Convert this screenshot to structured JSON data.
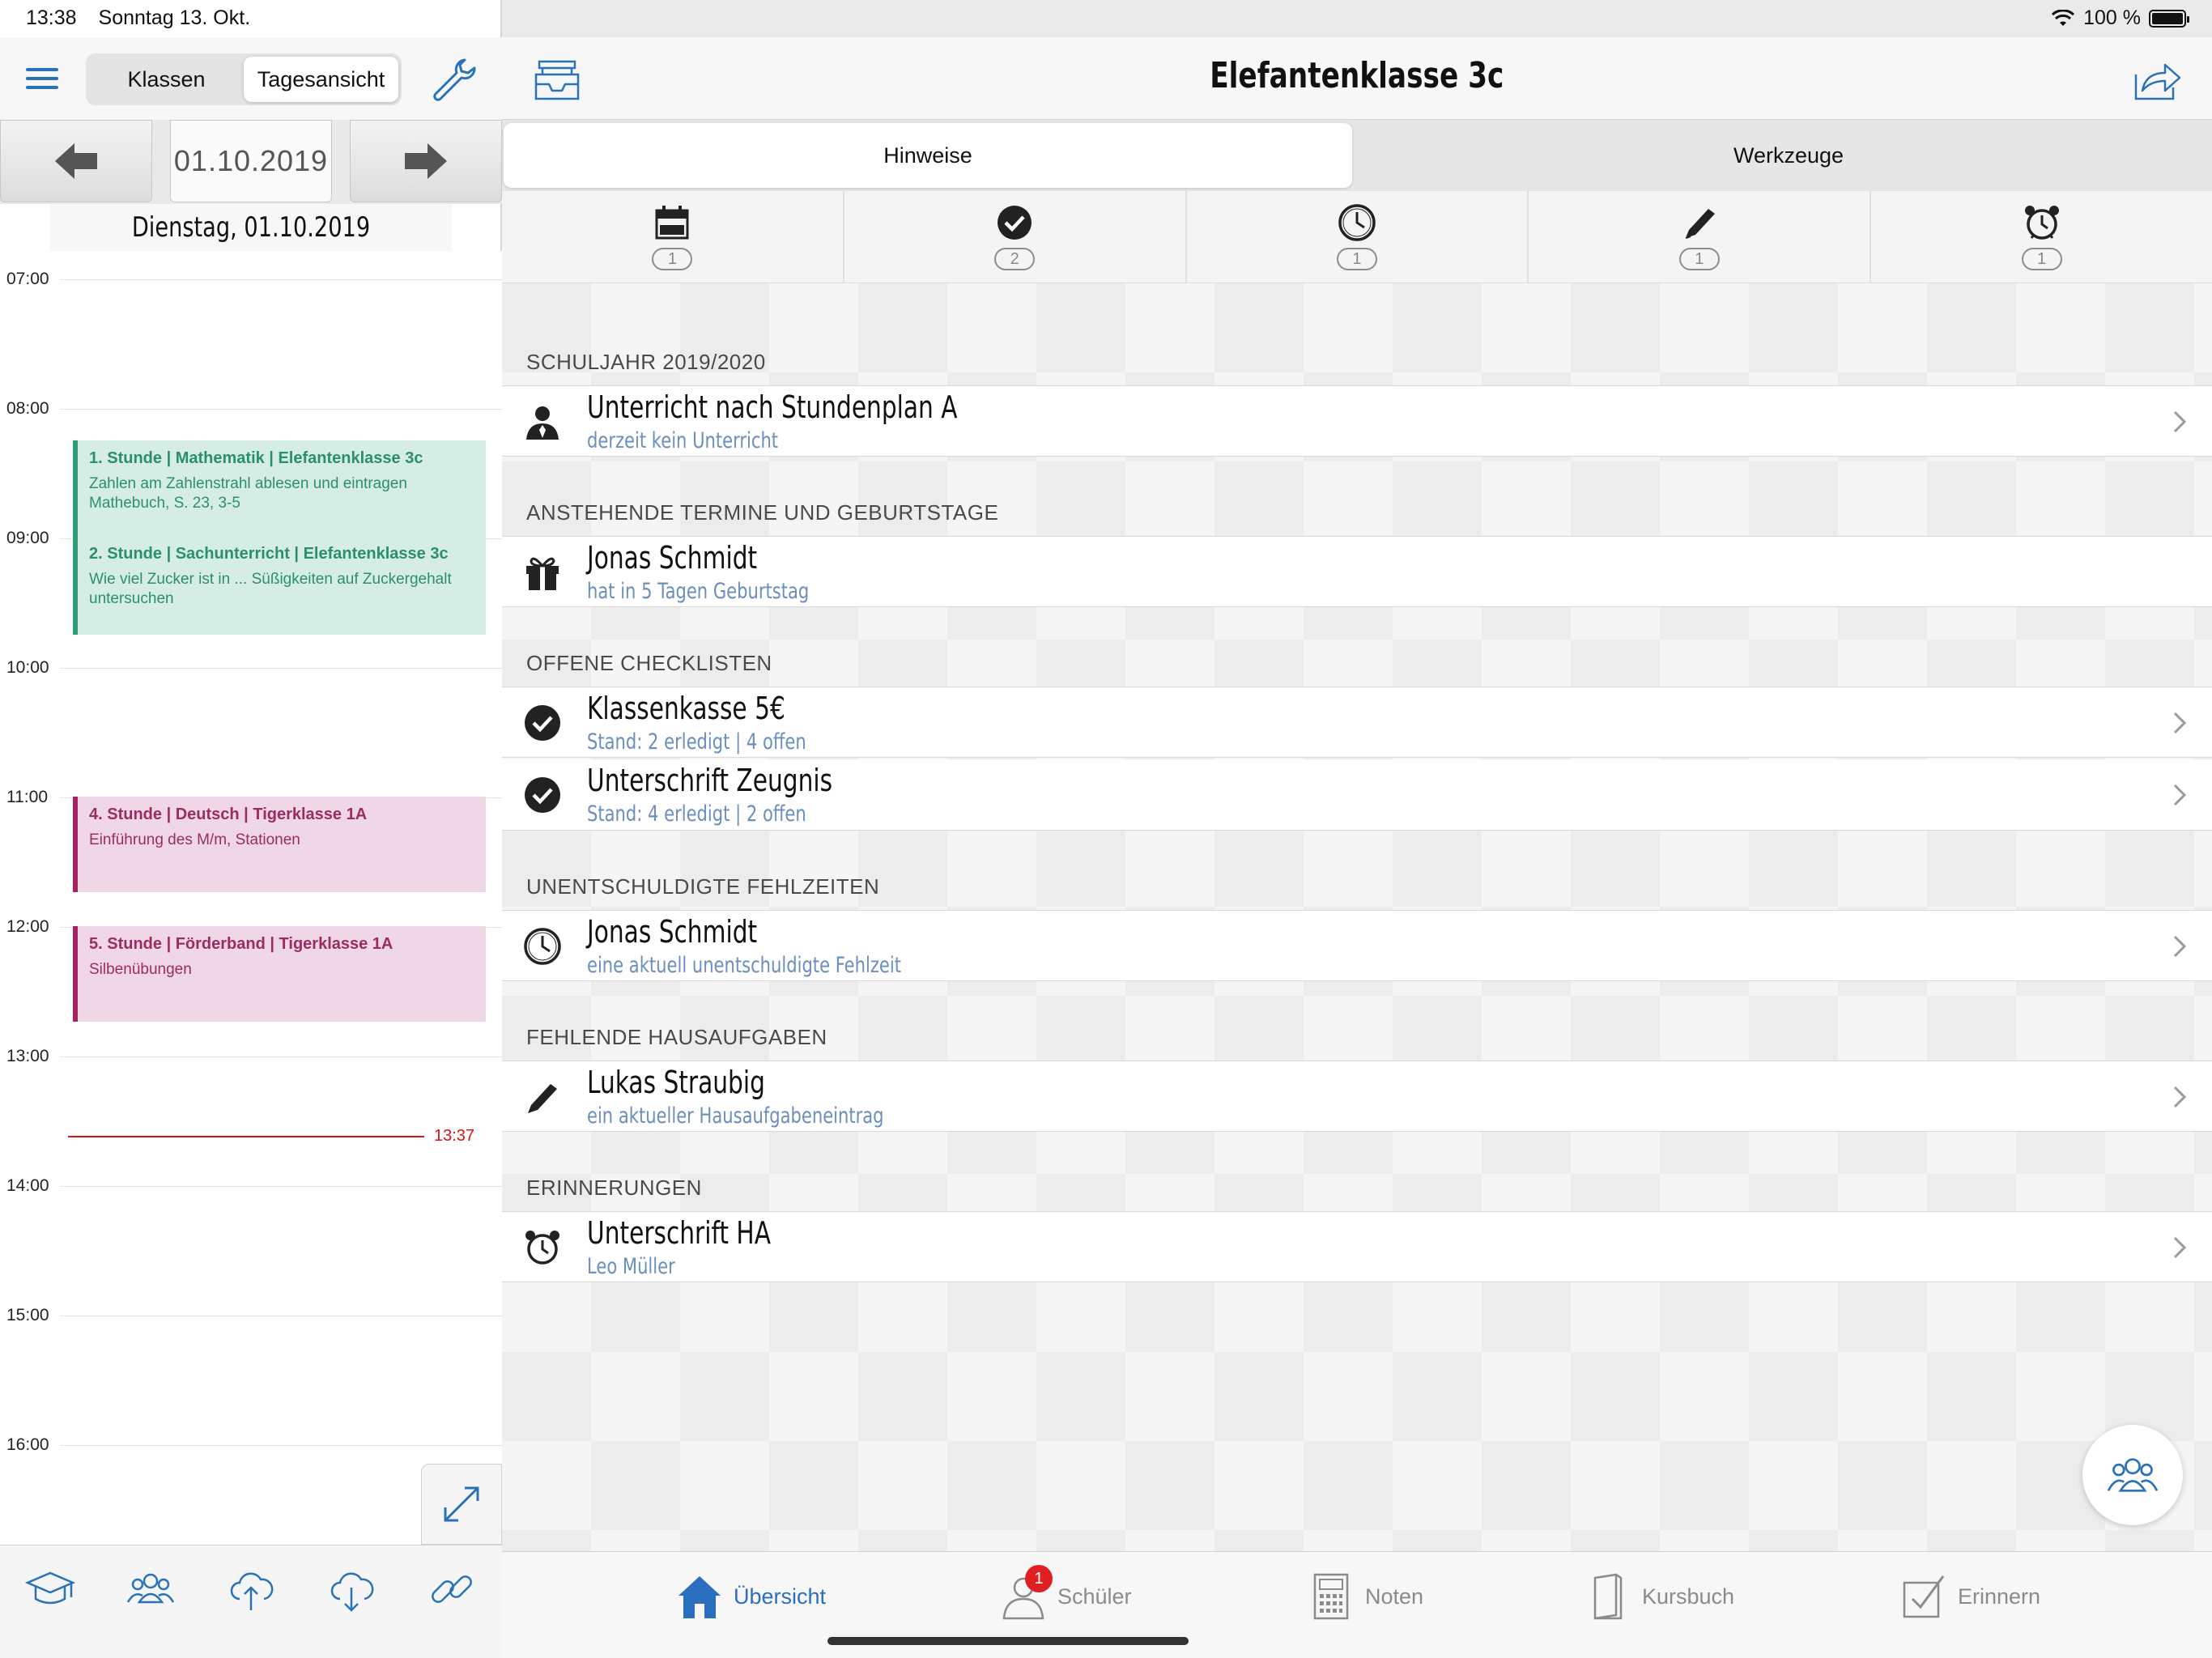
{
  "status_bar": {
    "time": "13:38",
    "date": "Sonntag 13. Okt.",
    "battery": "100 %"
  },
  "left": {
    "segments": [
      "Klassen",
      "Tagesansicht"
    ],
    "selected_segment": "Tagesansicht",
    "date": "01.10.2019",
    "day_title": "Dienstag, 01.10.2019",
    "hours": [
      "07:00",
      "08:00",
      "09:00",
      "10:00",
      "11:00",
      "12:00",
      "13:00",
      "14:00",
      "15:00",
      "16:00"
    ],
    "events": [
      {
        "title": "1. Stunde | Mathematik | Elefantenklasse 3c",
        "desc": "Zahlen am Zahlenstrahl ablesen und eintragen Mathebuch, S. 23, 3-5",
        "color": "green"
      },
      {
        "title": "2. Stunde | Sachunterricht | Elefantenklasse 3c",
        "desc": "Wie viel Zucker ist in ... Süßigkeiten auf Zuckergehalt untersuchen",
        "color": "green"
      },
      {
        "title": "4. Stunde | Deutsch | Tigerklasse 1A",
        "desc": "Einführung des M/m, Stationen",
        "color": "pink"
      },
      {
        "title": "5. Stunde | Förderband | Tigerklasse 1A",
        "desc": "Silbenübungen",
        "color": "pink"
      }
    ],
    "now_time": "13:37",
    "toolbar_icons": [
      "graduation-cap-icon",
      "group-icon",
      "cloud-upload-icon",
      "cloud-download-icon",
      "link-icon"
    ]
  },
  "right": {
    "title": "Elefantenklasse 3c",
    "tabs": [
      "Hinweise",
      "Werkzeuge"
    ],
    "active_tab": "Hinweise",
    "filters": [
      {
        "icon": "calendar-icon",
        "count": "1"
      },
      {
        "icon": "checkmark-icon",
        "count": "2"
      },
      {
        "icon": "clock-icon",
        "count": "1"
      },
      {
        "icon": "pen-icon",
        "count": "1"
      },
      {
        "icon": "alarm-clock-icon",
        "count": "1"
      }
    ],
    "sections": [
      {
        "title": "SCHULJAHR 2019/2020",
        "items": [
          {
            "icon": "person-icon",
            "title": "Unterricht nach Stundenplan A",
            "sub": "derzeit kein Unterricht",
            "chevron": true
          }
        ]
      },
      {
        "title": "ANSTEHENDE TERMINE UND GEBURTSTAGE",
        "items": [
          {
            "icon": "gift-icon",
            "title": "Jonas Schmidt",
            "sub": "hat in 5 Tagen Geburtstag",
            "chevron": false
          }
        ]
      },
      {
        "title": "OFFENE CHECKLISTEN",
        "items": [
          {
            "icon": "checkmark-icon",
            "title": "Klassenkasse 5€",
            "sub": "Stand: 2 erledigt | 4 offen",
            "chevron": true
          },
          {
            "icon": "checkmark-icon",
            "title": "Unterschrift Zeugnis",
            "sub": "Stand: 4 erledigt | 2 offen",
            "chevron": true
          }
        ]
      },
      {
        "title": "UNENTSCHULDIGTE FEHLZEITEN",
        "items": [
          {
            "icon": "clock-icon",
            "title": "Jonas Schmidt",
            "sub": "eine aktuell unentschuldigte Fehlzeit",
            "chevron": true
          }
        ]
      },
      {
        "title": "FEHLENDE HAUSAUFGABEN",
        "items": [
          {
            "icon": "pen-icon",
            "title": "Lukas Straubig",
            "sub": "ein aktueller Hausaufgabeneintrag",
            "chevron": true
          }
        ]
      },
      {
        "title": "ERINNERUNGEN",
        "items": [
          {
            "icon": "alarm-clock-icon",
            "title": "Unterschrift HA",
            "sub": "Leo Müller",
            "chevron": true
          }
        ]
      }
    ],
    "bottom_tabs": [
      {
        "label": "Übersicht",
        "icon": "home-icon",
        "active": true
      },
      {
        "label": "Schüler",
        "icon": "students-icon",
        "badge": "1"
      },
      {
        "label": "Noten",
        "icon": "calculator-icon"
      },
      {
        "label": "Kursbuch",
        "icon": "book-icon"
      },
      {
        "label": "Erinnern",
        "icon": "checkbox-icon"
      }
    ]
  },
  "colors": {
    "accent": "#2a6ec0",
    "green_event": "#2f9b78",
    "pink_event": "#a2235f",
    "now_line": "#dd1111",
    "subtitle": "#6b8fbc"
  }
}
